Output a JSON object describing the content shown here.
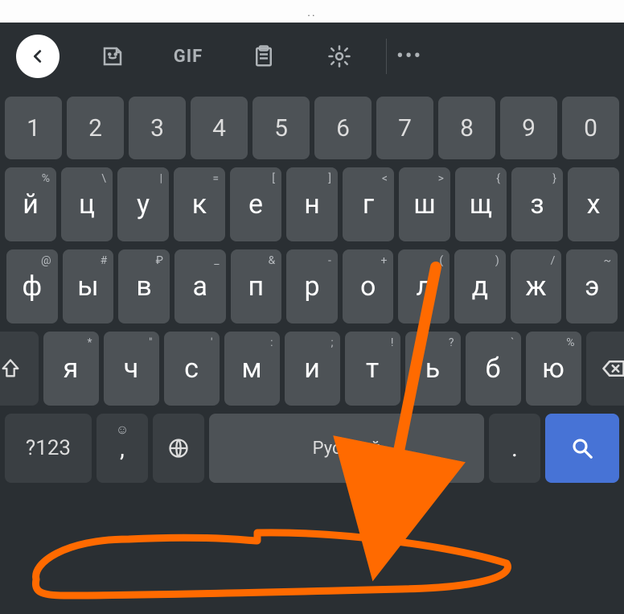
{
  "status": {
    "dots": ".."
  },
  "suggest": {
    "gif_label": "GIF",
    "more": "•••"
  },
  "rows": {
    "num": [
      {
        "k": "1"
      },
      {
        "k": "2"
      },
      {
        "k": "3"
      },
      {
        "k": "4"
      },
      {
        "k": "5"
      },
      {
        "k": "6"
      },
      {
        "k": "7"
      },
      {
        "k": "8"
      },
      {
        "k": "9"
      },
      {
        "k": "0"
      }
    ],
    "r2": [
      {
        "k": "й",
        "a": "%"
      },
      {
        "k": "ц",
        "a": "\\"
      },
      {
        "k": "у",
        "a": "|"
      },
      {
        "k": "к",
        "a": "="
      },
      {
        "k": "е",
        "a": "["
      },
      {
        "k": "н",
        "a": "]"
      },
      {
        "k": "г",
        "a": "<"
      },
      {
        "k": "ш",
        "a": ">"
      },
      {
        "k": "щ",
        "a": "{"
      },
      {
        "k": "з",
        "a": "}"
      },
      {
        "k": "х",
        "a": ""
      }
    ],
    "r3": [
      {
        "k": "ф",
        "a": "@"
      },
      {
        "k": "ы",
        "a": "#"
      },
      {
        "k": "в",
        "a": "₽"
      },
      {
        "k": "а",
        "a": "_"
      },
      {
        "k": "п",
        "a": "&"
      },
      {
        "k": "р",
        "a": "-"
      },
      {
        "k": "о",
        "a": "+"
      },
      {
        "k": "л",
        "a": "("
      },
      {
        "k": "д",
        "a": ")"
      },
      {
        "k": "ж",
        "a": "/"
      },
      {
        "k": "э",
        "a": "~"
      }
    ],
    "r4": [
      {
        "k": "я",
        "a": "*"
      },
      {
        "k": "ч",
        "a": "\""
      },
      {
        "k": "с",
        "a": "'"
      },
      {
        "k": "м",
        "a": ":"
      },
      {
        "k": "и",
        "a": ";"
      },
      {
        "k": "т",
        "a": "!"
      },
      {
        "k": "ь",
        "a": "?"
      },
      {
        "k": "б",
        "a": "`"
      },
      {
        "k": "ю",
        "a": "%"
      }
    ]
  },
  "bottom": {
    "symbols": "?123",
    "comma": ",",
    "comma_alt": "☺",
    "space": "Русский",
    "period": "."
  }
}
